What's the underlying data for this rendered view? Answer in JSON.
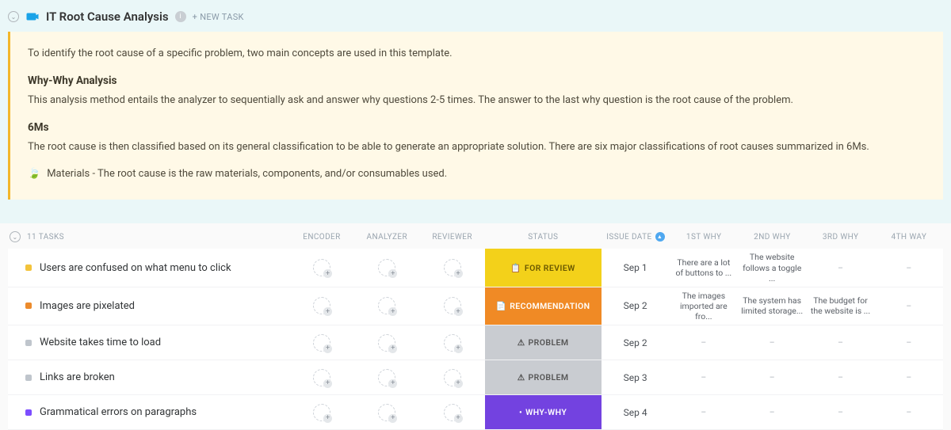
{
  "header": {
    "title": "IT Root Cause Analysis",
    "new_task_label": "+ NEW TASK"
  },
  "description": {
    "intro": "To identify the root cause of a specific problem, two main concepts are used in this template.",
    "whywhy_title": "Why-Why Analysis",
    "whywhy_body": "This analysis method entails the analyzer to sequentially ask and answer why questions 2-5 times. The answer to the last why question is the root cause of the problem.",
    "sixms_title": "6Ms",
    "sixms_body": "The root cause is then classified based on its general classification to be able to generate an appropriate solution. There are six major classifications of root causes summarized in 6Ms.",
    "materials_line": "Materials - The root cause is the raw materials, components, and/or consumables used."
  },
  "columns": {
    "tasks_count": "11 TASKS",
    "encoder": "ENCODER",
    "analyzer": "ANALYZER",
    "reviewer": "REVIEWER",
    "status": "STATUS",
    "issue_date": "ISSUE DATE",
    "first_why": "1ST WHY",
    "second_why": "2ND WHY",
    "third_why": "3RD WHY",
    "fourth_why": "4TH WAY"
  },
  "status_labels": {
    "review": "FOR REVIEW",
    "recommendation": "RECOMMENDATION",
    "problem": "PROBLEM",
    "whywhy": "WHY-WHY"
  },
  "tasks": [
    {
      "bullet": "yellow",
      "title": "Users are confused on what menu to click",
      "status": "review",
      "date": "Sep 1",
      "why1": "There are a lot of buttons to ...",
      "why2": "The website follows a toggle ...",
      "why3": "–",
      "why4": "–"
    },
    {
      "bullet": "orange",
      "title": "Images are pixelated",
      "status": "recommendation",
      "date": "Sep 2",
      "why1": "The images imported are fro...",
      "why2": "The system has limited storage...",
      "why3": "The budget for the website is ...",
      "why4": "–"
    },
    {
      "bullet": "grey",
      "title": "Website takes time to load",
      "status": "problem",
      "date": "Sep 2",
      "why1": "–",
      "why2": "–",
      "why3": "–",
      "why4": "–"
    },
    {
      "bullet": "grey",
      "title": "Links are broken",
      "status": "problem",
      "date": "Sep 3",
      "why1": "–",
      "why2": "–",
      "why3": "–",
      "why4": "–"
    },
    {
      "bullet": "purple",
      "title": "Grammatical errors on paragraphs",
      "status": "whywhy",
      "date": "Sep 4",
      "why1": "–",
      "why2": "–",
      "why3": "–",
      "why4": "–"
    }
  ]
}
